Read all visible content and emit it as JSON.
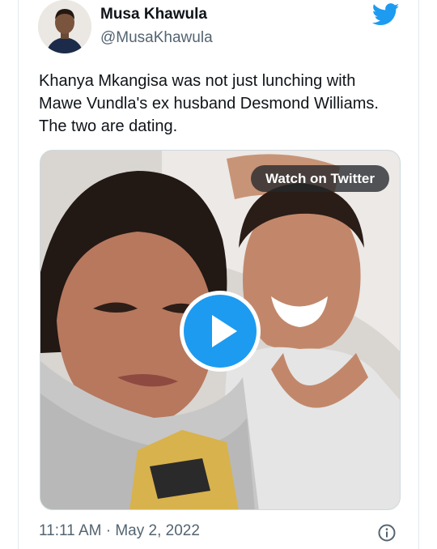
{
  "author": {
    "display_name": "Musa Khawula",
    "handle": "@MusaKhawula"
  },
  "icons": {
    "brand": "twitter-bird-icon",
    "play": "play-icon",
    "info": "info-icon"
  },
  "tweet": {
    "text": "Khanya Mkangisa was not just lunching with Mawe Vundla's ex husband Desmond Williams. The two are dating.",
    "media": {
      "type": "video",
      "overlay_label": "Watch on Twitter"
    },
    "timestamp": "11:11 AM · May 2, 2022"
  },
  "colors": {
    "accent": "#1d9bf0",
    "text": "#0f1419",
    "secondary_text": "#536471",
    "border": "#e1e8ed"
  }
}
